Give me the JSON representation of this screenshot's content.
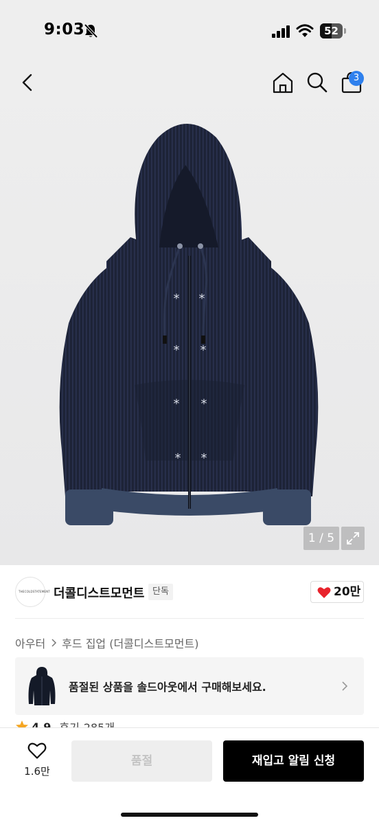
{
  "status_bar": {
    "time": "9:03",
    "battery_level": "52",
    "icons": [
      "bell-slash-icon",
      "signal-icon",
      "wifi-icon",
      "battery-icon"
    ]
  },
  "header": {
    "icons": [
      "chevron-left-icon",
      "home-icon",
      "search-icon",
      "cart-icon"
    ],
    "cart_badge": "3"
  },
  "gallery": {
    "page_indicator": "1 / 5",
    "expand_icon": "expand-arrows-icon"
  },
  "brand": {
    "logo_text": "THECOLDSTATEMENT",
    "name": "더콜디스트모먼트",
    "badge": "단독",
    "like_count": "20만",
    "like_color": "#e8232c"
  },
  "breadcrumb": {
    "category": "아우터",
    "subcategory": "후드 집업 (더콜디스트모먼트)"
  },
  "soldout_banner": {
    "text": "품절된 상품을 솔드아웃에서 구매해보세요."
  },
  "rating": {
    "score": "4.9",
    "review_label": "후기",
    "review_count": "285개",
    "star_color": "#f5a623"
  },
  "bottom_bar": {
    "wish_count": "1.6만",
    "soldout_label": "품절",
    "restock_label": "재입고 알림 신청"
  },
  "colors": {
    "accent": "#2f80ed",
    "primary_button": "#000000",
    "disabled_button": "#eeeeee"
  }
}
